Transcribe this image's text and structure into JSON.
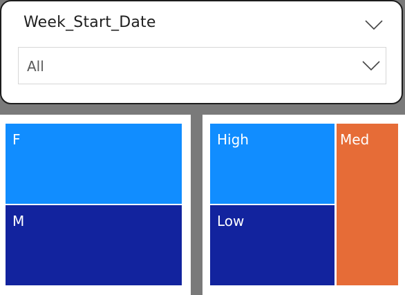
{
  "slicer": {
    "title": "Week_Start_Date",
    "header_icon": "chevron-down-icon",
    "dropdown": {
      "selected_value": "All",
      "icon": "chevron-down-icon"
    }
  },
  "gender_treemap": {
    "tiles": [
      {
        "label": "F",
        "color": "#118DFF"
      },
      {
        "label": "M",
        "color": "#12239E"
      }
    ]
  },
  "level_treemap": {
    "tiles": [
      {
        "label": "High",
        "color": "#118DFF"
      },
      {
        "label": "Low",
        "color": "#12239E"
      },
      {
        "label": "Med",
        "color": "#E66C37"
      }
    ]
  }
}
